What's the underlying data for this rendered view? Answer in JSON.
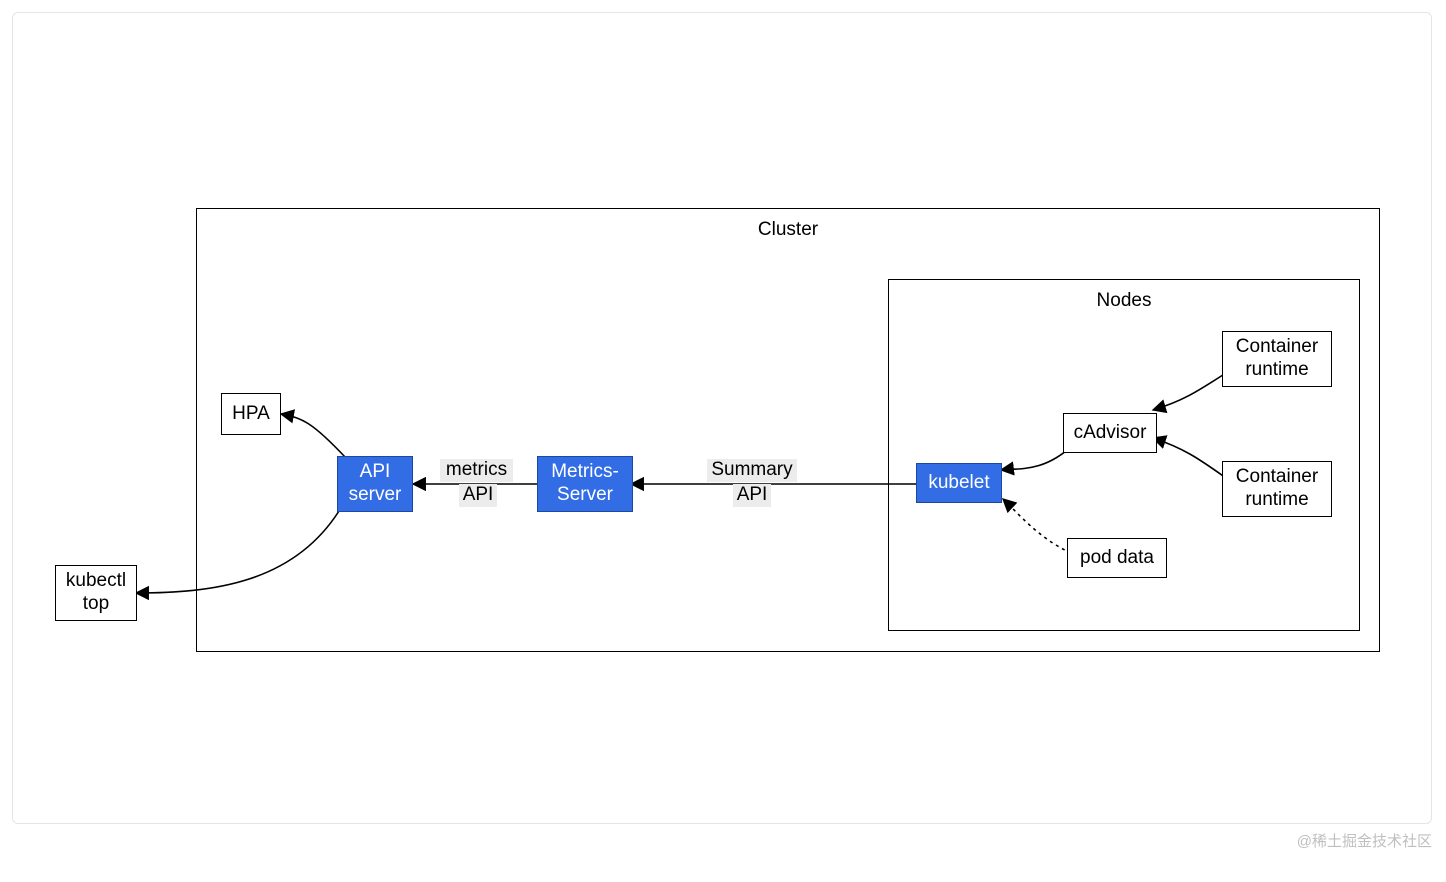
{
  "diagram": {
    "groups": {
      "cluster": {
        "label": "Cluster"
      },
      "nodes": {
        "label": "Nodes"
      }
    },
    "boxes": {
      "hpa": {
        "label": "HPA"
      },
      "api_server": {
        "label": "API\nserver"
      },
      "metrics_server": {
        "label": "Metrics-\nServer"
      },
      "kubelet": {
        "label": "kubelet"
      },
      "cadvisor": {
        "label": "cAdvisor"
      },
      "pod_data": {
        "label": "pod data"
      },
      "cr_top": {
        "label": "Container\nruntime"
      },
      "cr_bottom": {
        "label": "Container\nruntime"
      },
      "kubectl_top": {
        "label": "kubectl\ntop"
      }
    },
    "edges": {
      "metrics_api": {
        "label1": "metrics",
        "label2": "API"
      },
      "summary_api": {
        "label1": "Summary",
        "label2": "API"
      }
    }
  },
  "watermark": "@稀土掘金技术社区",
  "colors": {
    "blue_fill": "#326de6",
    "blue_stroke": "#1c48a0",
    "label_bg": "#ececec"
  }
}
